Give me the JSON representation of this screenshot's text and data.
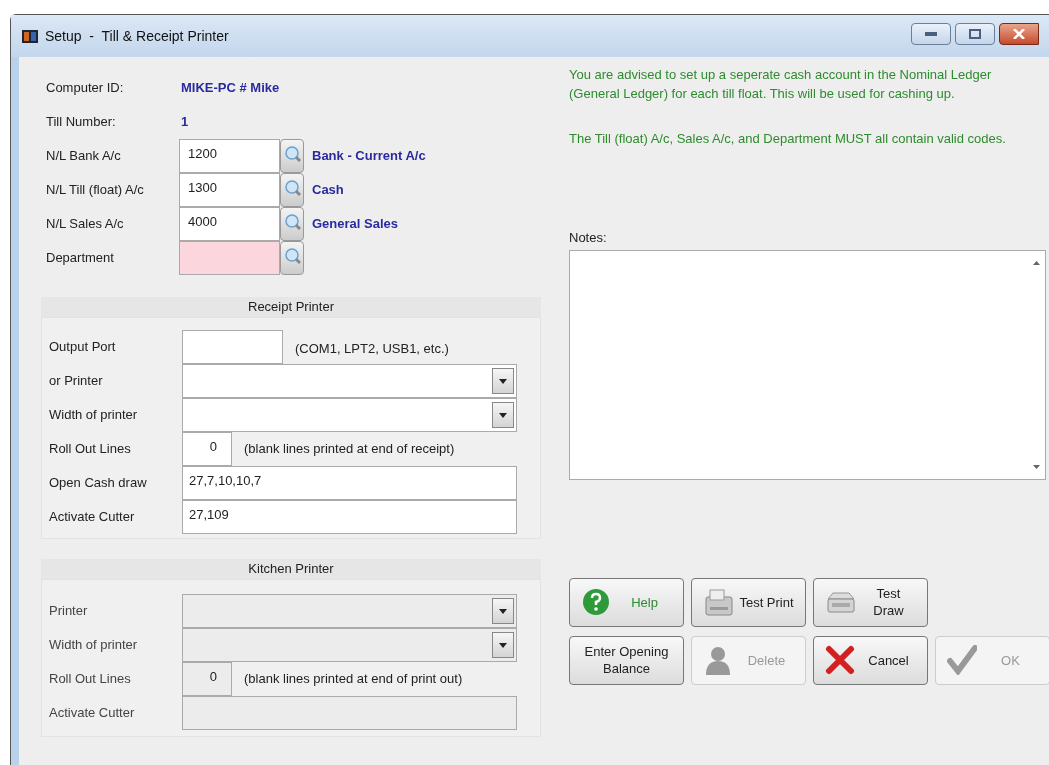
{
  "window": {
    "title": "Setup  -  Till & Receipt Printer"
  },
  "info": [
    {
      "label": "Computer ID:",
      "value": "MIKE-PC # Mike"
    },
    {
      "label": "Till Number:",
      "value": "1"
    }
  ],
  "accounts": [
    {
      "label": "N/L Bank A/c",
      "code": "1200",
      "description": "Bank - Current A/c",
      "invalid": false
    },
    {
      "label": "N/L Till (float) A/c",
      "code": "1300",
      "description": "Cash",
      "invalid": false
    },
    {
      "label": "N/L Sales A/c",
      "code": "4000",
      "description": "General Sales",
      "invalid": false
    },
    {
      "label": "Department",
      "invalid": true
    }
  ],
  "advice": [
    "You are advised to set up a seperate cash account in the Nominal Ledger (General Ledger) for each till float.  This will be used for cashing up.",
    "The Till (float) A/c, Sales A/c, and Department MUST all contain valid codes."
  ],
  "receipt_printer": {
    "title": "Receipt Printer",
    "disabled": false,
    "fields": [
      {
        "kind": "short",
        "label": "Output Port",
        "hint": "(COM1, LPT2,  USB1, etc.)"
      },
      {
        "kind": "dropdown",
        "label": "or Printer"
      },
      {
        "kind": "dropdown",
        "label": "Width of printer"
      },
      {
        "kind": "number",
        "label": "Roll Out Lines",
        "value": "0",
        "hint": "(blank lines printed at end of receipt)"
      },
      {
        "kind": "text",
        "label": "Open Cash draw",
        "value": "27,7,10,10,7"
      },
      {
        "kind": "text",
        "label": "Activate Cutter",
        "value": "27,109"
      }
    ]
  },
  "kitchen_printer": {
    "title": "Kitchen Printer",
    "disabled": true,
    "fields": [
      {
        "kind": "dropdown",
        "label": "Printer"
      },
      {
        "kind": "dropdown",
        "label": "Width of printer"
      },
      {
        "kind": "number",
        "label": "Roll Out Lines",
        "value": "0",
        "hint": "(blank lines printed at end of print out)"
      },
      {
        "kind": "text",
        "label": "Activate Cutter"
      }
    ]
  },
  "notes": {
    "label": "Notes:"
  },
  "buttons": [
    {
      "kind": "help",
      "label": "Help",
      "disabled": false
    },
    {
      "kind": "print",
      "label": "Test Print",
      "disabled": false
    },
    {
      "kind": "drawer",
      "label": "Test Draw",
      "disabled": false
    },
    {
      "kind": "balance",
      "label": "Enter Opening Balance",
      "disabled": false
    },
    {
      "kind": "delete",
      "label": "Delete",
      "disabled": true
    },
    {
      "kind": "cancel",
      "label": "Cancel",
      "disabled": false
    },
    {
      "kind": "ok",
      "label": "OK",
      "disabled": true
    }
  ]
}
